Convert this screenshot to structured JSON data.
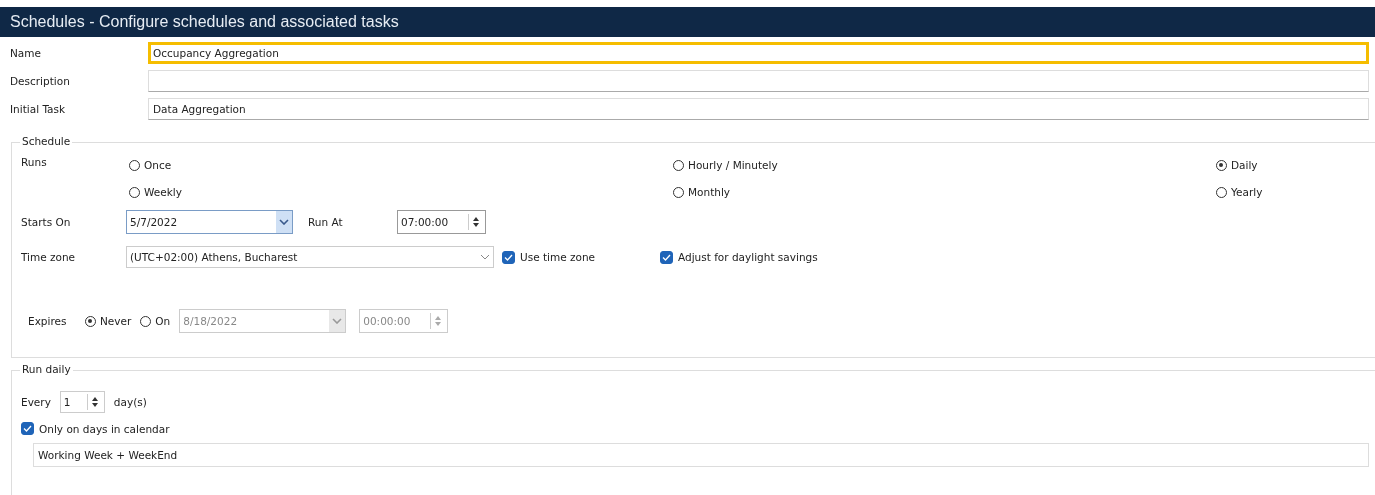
{
  "window": {
    "title": "Schedules - Configure schedules and associated tasks"
  },
  "fields": [
    {
      "label": "Name",
      "value": "Occupancy Aggregation",
      "focused": true
    },
    {
      "label": "Description",
      "focused": false
    },
    {
      "label": "Initial Task",
      "value": "Data Aggregation",
      "focused": false
    }
  ],
  "schedule": {
    "title": "Schedule",
    "runs_label": "Runs",
    "runs_options": [
      {
        "label": "Once",
        "selected": false
      },
      {
        "label": "Hourly / Minutely",
        "selected": false
      },
      {
        "label": "Daily",
        "selected": true
      },
      {
        "label": "Weekly",
        "selected": false
      },
      {
        "label": "Monthly",
        "selected": false
      },
      {
        "label": "Yearly",
        "selected": false
      }
    ],
    "starts_on": {
      "label": "Starts On",
      "value": "5/7/2022"
    },
    "run_at": {
      "label": "Run At",
      "value": "07:00:00"
    },
    "time_zone": {
      "label": "Time zone",
      "value": "(UTC+02:00) Athens, Bucharest"
    },
    "use_time_zone": {
      "label": "Use time zone",
      "checked": true
    },
    "adjust_dst": {
      "label": "Adjust for daylight savings",
      "checked": true
    },
    "expires": {
      "label": "Expires",
      "options": [
        {
          "label": "Never",
          "selected": true
        },
        {
          "label": "On",
          "selected": false
        }
      ],
      "date": {
        "value": "8/18/2022",
        "disabled": true
      },
      "time": {
        "value": "00:00:00",
        "disabled": true
      }
    }
  },
  "run_daily": {
    "title": "Run daily",
    "every_label": "Every",
    "every_value": "1",
    "unit": "day(s)",
    "only_calendar": {
      "label": "Only on days in calendar",
      "checked": true
    },
    "calendar": "Working Week + WeekEnd"
  }
}
